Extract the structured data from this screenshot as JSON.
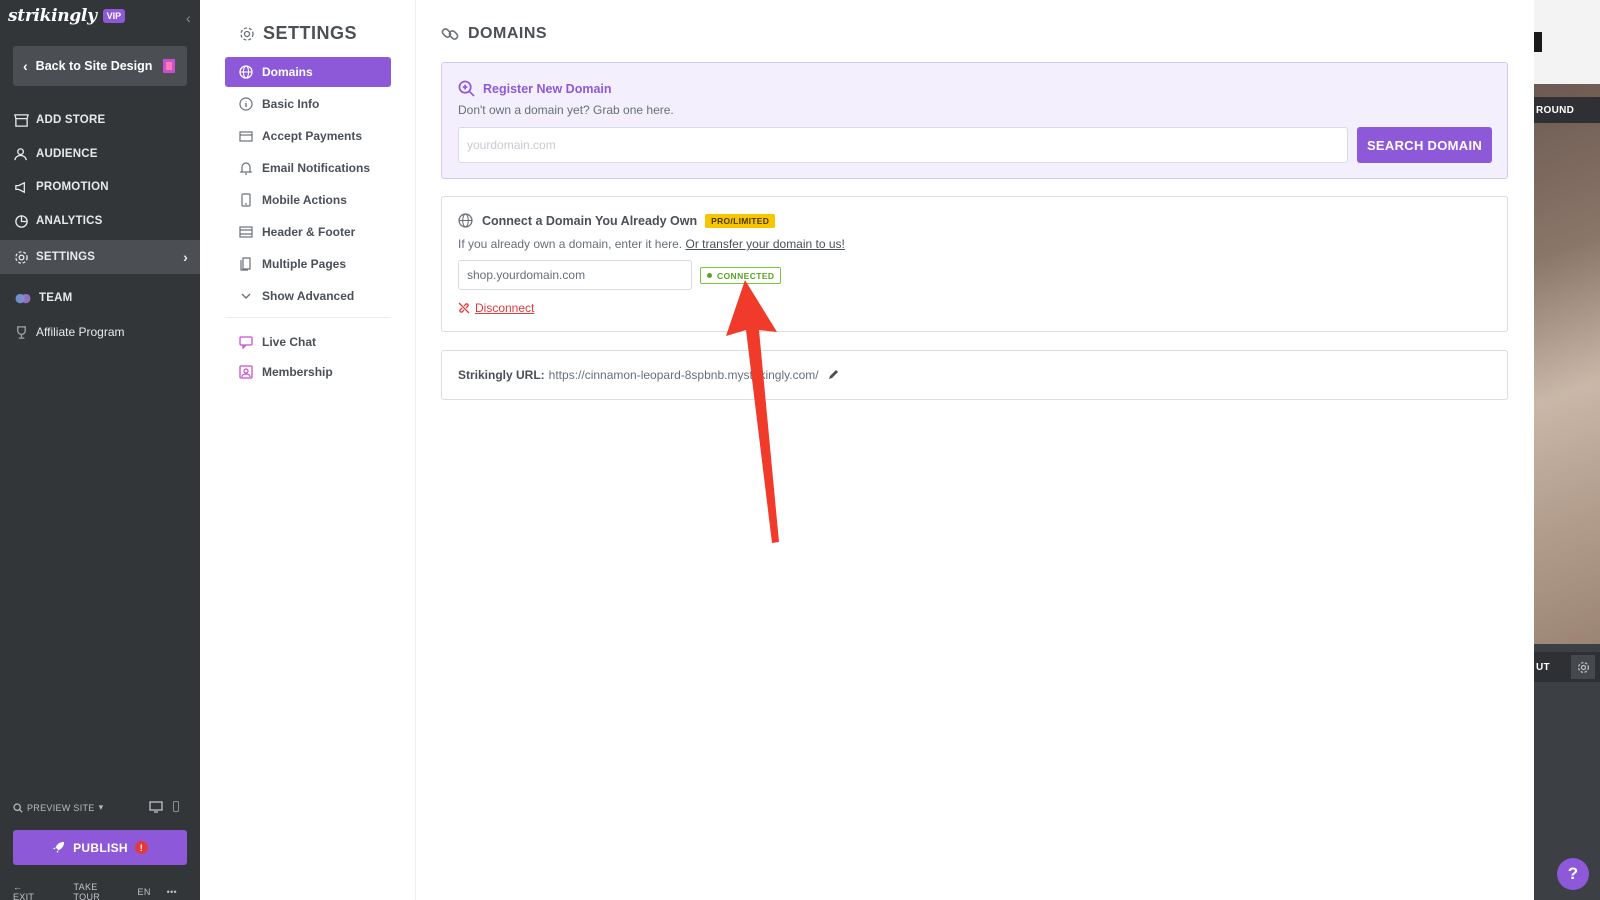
{
  "app": {
    "brand": "strikingly",
    "vip_label": "VIP",
    "back_label": "Back to Site Design"
  },
  "sidebar": {
    "items": [
      {
        "label": "ADD STORE",
        "icon": "store-icon"
      },
      {
        "label": "AUDIENCE",
        "icon": "audience-icon"
      },
      {
        "label": "PROMOTION",
        "icon": "megaphone-icon"
      },
      {
        "label": "ANALYTICS",
        "icon": "pie-chart-icon"
      },
      {
        "label": "SETTINGS",
        "icon": "gear-icon",
        "active": true
      },
      {
        "label": "TEAM",
        "icon": "team-icon"
      },
      {
        "label": "Affiliate Program",
        "icon": "trophy-icon"
      }
    ],
    "preview_label": "PREVIEW SITE",
    "publish_label": "PUBLISH",
    "publish_alert": "!",
    "bottom": {
      "exit": "EXIT",
      "take_tour": "TAKE TOUR",
      "lang": "EN",
      "more": "•••"
    }
  },
  "settings_nav": {
    "title": "SETTINGS",
    "items": [
      {
        "label": "Domains",
        "icon": "globe-icon",
        "active": true
      },
      {
        "label": "Basic Info",
        "icon": "info-icon"
      },
      {
        "label": "Accept Payments",
        "icon": "credit-card-icon"
      },
      {
        "label": "Email Notifications",
        "icon": "bell-icon"
      },
      {
        "label": "Mobile Actions",
        "icon": "mobile-icon"
      },
      {
        "label": "Header & Footer",
        "icon": "layout-icon"
      },
      {
        "label": "Multiple Pages",
        "icon": "pages-icon"
      },
      {
        "label": "Show Advanced",
        "icon": "chevron-down-icon"
      },
      {
        "label": "Live Chat",
        "icon": "chat-icon"
      },
      {
        "label": "Membership",
        "icon": "membership-icon"
      }
    ]
  },
  "main": {
    "title": "DOMAINS",
    "register": {
      "title": "Register New Domain",
      "subtitle": "Don't own a domain yet? Grab one here.",
      "placeholder": "yourdomain.com",
      "button": "SEARCH DOMAIN"
    },
    "connect": {
      "title": "Connect a Domain You Already Own",
      "badge": "PRO/LIMITED",
      "subtitle": "If you already own a domain, enter it here.",
      "transfer_link": "Or transfer your domain to us!",
      "value": "shop.yourdomain.com",
      "status": "CONNECTED",
      "disconnect": "Disconnect"
    },
    "url": {
      "label": "Strikingly URL:",
      "value": "https://cinnamon-leopard-8spbnb.mystrikingly.com/"
    }
  },
  "preview_strip": {
    "btn_top": "ROUND",
    "btn_bottom": "UT"
  },
  "help": "?",
  "colors": {
    "accent": "#8d59d8",
    "sidebar_bg": "#333639",
    "connected": "#5aa420",
    "pro_badge": "#f7c600",
    "danger": "#e23a3a",
    "arrow": "#f03a2a"
  }
}
